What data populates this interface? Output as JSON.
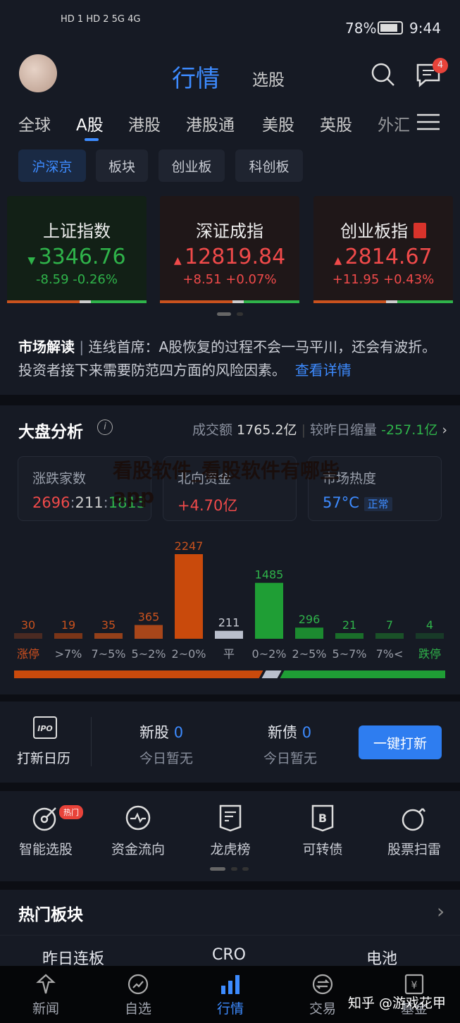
{
  "status_bar": {
    "signal_left": "HD 1 HD 2 5G 4G",
    "battery": "78%",
    "time": "9:44"
  },
  "header": {
    "title": "行情",
    "secondary_tab": "选股",
    "message_badge": "4"
  },
  "market_tabs": [
    "全球",
    "A股",
    "港股",
    "港股通",
    "美股",
    "英股",
    "外汇"
  ],
  "active_market_tab": "A股",
  "sub_tabs": [
    "沪深京",
    "板块",
    "创业板",
    "科创板"
  ],
  "indices": [
    {
      "name": "上证指数",
      "price": "3346.76",
      "change": "-8.59 -0.26%",
      "direction": "down"
    },
    {
      "name": "深证成指",
      "price": "12819.84",
      "change": "+8.51 +0.07%",
      "direction": "up"
    },
    {
      "name": "创业板指",
      "price": "2814.67",
      "change": "+11.95 +0.43%",
      "direction": "up"
    }
  ],
  "commentary": {
    "label": "市场解读",
    "text": "连线首席：A股恢复的过程不会一马平川，还会有波折。投资者接下来需要防范四方面的风险因素。",
    "link": "查看详情"
  },
  "analysis": {
    "title": "大盘分析",
    "turnover_label": "成交额",
    "turnover": "1765.2亿",
    "compare_label": "较昨日缩量",
    "compare": "-257.1亿",
    "boxes": [
      {
        "title": "涨跌家数",
        "up": "2696",
        "flat": "211",
        "down": "1813"
      },
      {
        "title": "北向资金",
        "value": "+4.70亿"
      },
      {
        "title": "市场热度",
        "value": "57°C",
        "badge": "正常"
      }
    ]
  },
  "chart_data": {
    "type": "bar",
    "categories": [
      "涨停",
      ">7%",
      "7~5%",
      "5~2%",
      "2~0%",
      "平",
      "0~2%",
      "2~5%",
      "5~7%",
      "7%<",
      "跌停"
    ],
    "values": [
      30,
      19,
      35,
      365,
      2247,
      211,
      1485,
      296,
      21,
      7,
      4
    ],
    "colors": [
      "#4a2a22",
      "#7a3518",
      "#94401a",
      "#a8461a",
      "#c94a0c",
      "#b9bfcc",
      "#1f9e35",
      "#1c8a30",
      "#1a6e2a",
      "#1a5128",
      "#183a28"
    ],
    "label_colors": [
      "#d0501e",
      "#9a9ea8",
      "#9a9ea8",
      "#9a9ea8",
      "#9a9ea8",
      "#9a9ea8",
      "#9a9ea8",
      "#9a9ea8",
      "#9a9ea8",
      "#9a9ea8",
      "#2fb34a"
    ],
    "value_colors": [
      "#c9521e",
      "#c9521e",
      "#c9521e",
      "#c9521e",
      "#c9521e",
      "#c9ccd4",
      "#2fb34a",
      "#2fb34a",
      "#2fb34a",
      "#2fb34a",
      "#2fb34a"
    ]
  },
  "ipo": {
    "calendar": "打新日历",
    "new_stock_label": "新股",
    "new_stock_count": "0",
    "new_stock_sub": "今日暂无",
    "new_bond_label": "新债",
    "new_bond_count": "0",
    "new_bond_sub": "今日暂无",
    "button": "一键打新"
  },
  "shortcuts": [
    {
      "label": "智能选股",
      "badge": "热门"
    },
    {
      "label": "资金流向"
    },
    {
      "label": "龙虎榜"
    },
    {
      "label": "可转债"
    },
    {
      "label": "股票扫雷"
    }
  ],
  "hot_sectors": {
    "title": "热门板块",
    "items": [
      "昨日连板",
      "CRO",
      "电池"
    ]
  },
  "bottom_nav": [
    "新闻",
    "自选",
    "行情",
    "交易",
    "基金"
  ],
  "active_nav": "行情",
  "watermarks": {
    "center": "看股软件_看股软件有哪些app",
    "corner": "知乎 @游戏花甲"
  }
}
